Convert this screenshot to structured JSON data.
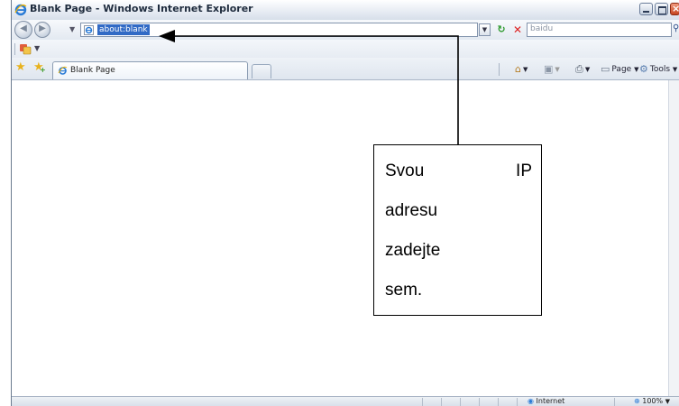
{
  "window": {
    "title": "Blank Page - Windows Internet Explorer"
  },
  "navigation": {
    "address_value": "about:blank",
    "search_placeholder": "baidu"
  },
  "tabs": [
    {
      "label": "Blank Page"
    }
  ],
  "command_bar": {
    "page_label": "Page",
    "tools_label": "Tools"
  },
  "status_bar": {
    "zone": "Internet",
    "zoom": "100%"
  },
  "annotation": {
    "word1": "Svou",
    "word2": "IP",
    "line2": "adresu",
    "line3": "zadejte",
    "line4": "sem."
  }
}
